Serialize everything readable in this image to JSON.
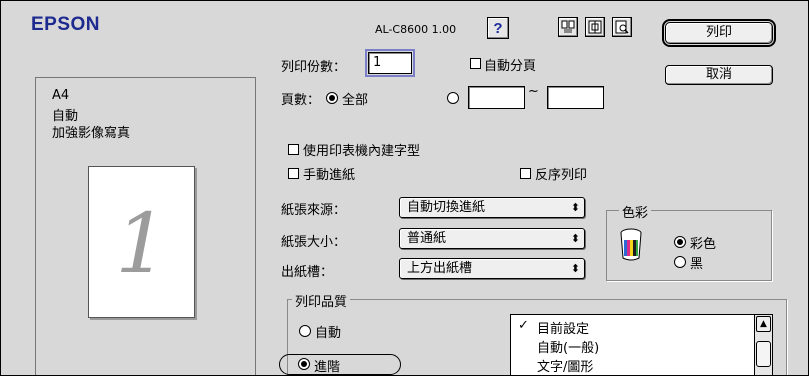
{
  "header": {
    "brand": "EPSON",
    "model": "AL-C8600 1.00",
    "help_label": "?",
    "icons": [
      "layout-icon",
      "page-setup-icon",
      "preview-icon"
    ]
  },
  "buttons": {
    "print": "列印",
    "cancel": "取消"
  },
  "preview": {
    "paper_size": "A4",
    "mode": "自動",
    "option": "加強影像寫真",
    "page_number": "1"
  },
  "copies": {
    "label": "列印份數：",
    "value": "1",
    "collate_label": "自動分頁",
    "collate_checked": false
  },
  "pages": {
    "label": "頁數：",
    "all_label": "全部",
    "all_selected": true,
    "range_separator": "~",
    "from": "",
    "to": ""
  },
  "options": {
    "printer_fonts": "使用印表機內建字型",
    "manual_feed": "手動進紙",
    "reverse_order": "反序列印"
  },
  "paper": {
    "source_label": "紙張來源：",
    "source_value": "自動切換進紙",
    "size_label": "紙張大小：",
    "size_value": "普通紙",
    "output_label": "出紙槽：",
    "output_value": "上方出紙槽"
  },
  "color": {
    "title": "色彩",
    "color_label": "彩色",
    "black_label": "黑",
    "selected": "彩色"
  },
  "quality": {
    "title": "列印品質",
    "auto_label": "自動",
    "advanced_label": "進階",
    "selected": "進階",
    "settings_list": [
      "目前設定",
      "自動(一般)",
      "文字/圖形"
    ],
    "checked_item": "目前設定"
  }
}
